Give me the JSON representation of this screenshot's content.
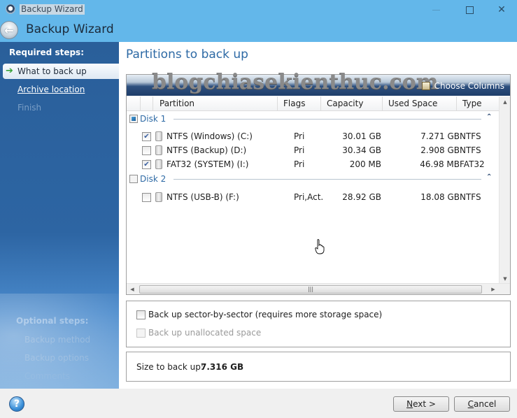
{
  "window": {
    "title": "Backup Wizard",
    "controls": {
      "minimize": "minimize",
      "maximize": "maximize",
      "close": "close"
    }
  },
  "header": {
    "title": "Backup Wizard",
    "back_icon": "back-arrow-icon"
  },
  "sidebar": {
    "required_heading": "Required steps:",
    "required_items": [
      {
        "label": "What to back up",
        "state": "active"
      },
      {
        "label": "Archive location",
        "state": "link"
      },
      {
        "label": "Finish",
        "state": "disabled"
      }
    ],
    "optional_heading": "Optional steps:",
    "optional_items": [
      {
        "label": "Backup method",
        "state": "disabled"
      },
      {
        "label": "Backup options",
        "state": "disabled"
      },
      {
        "label": "Comments",
        "state": "disabled"
      }
    ]
  },
  "main": {
    "title": "Partitions to back up",
    "watermark": "blogchiasekienthuc.com",
    "choose_columns": "Choose Columns",
    "columns": [
      "Partition",
      "Flags",
      "Capacity",
      "Used Space",
      "Type"
    ],
    "disks": [
      {
        "name": "Disk 1",
        "state": "partial",
        "partitions": [
          {
            "name": "NTFS (Windows) (C:)",
            "checked": true,
            "flags": "Pri",
            "capacity": "30.01 GB",
            "used": "7.271 GB",
            "type": "NTFS"
          },
          {
            "name": "NTFS (Backup) (D:)",
            "checked": false,
            "flags": "Pri",
            "capacity": "30.34 GB",
            "used": "2.908 GB",
            "type": "NTFS"
          },
          {
            "name": "FAT32 (SYSTEM) (I:)",
            "checked": true,
            "flags": "Pri",
            "capacity": "200 MB",
            "used": "46.98 MB",
            "type": "FAT32"
          }
        ]
      },
      {
        "name": "Disk 2",
        "state": "unchecked",
        "partitions": [
          {
            "name": "NTFS (USB-B) (F:)",
            "checked": false,
            "flags": "Pri,Act.",
            "capacity": "28.92 GB",
            "used": "18.08 GB",
            "type": "NTFS"
          }
        ]
      }
    ],
    "options": {
      "sector_by_sector": {
        "label": "Back up sector-by-sector (requires more storage space)",
        "checked": false,
        "enabled": true
      },
      "unallocated": {
        "label": "Back up unallocated space",
        "checked": false,
        "enabled": false
      }
    },
    "size": {
      "label": "Size to back up:",
      "value": "7.316 GB"
    }
  },
  "footer": {
    "help_icon": "help-icon",
    "next_label_mnemonic": "N",
    "next_label_rest": "ext >",
    "cancel_label_mnemonic": "C",
    "cancel_label_rest": "ancel"
  }
}
